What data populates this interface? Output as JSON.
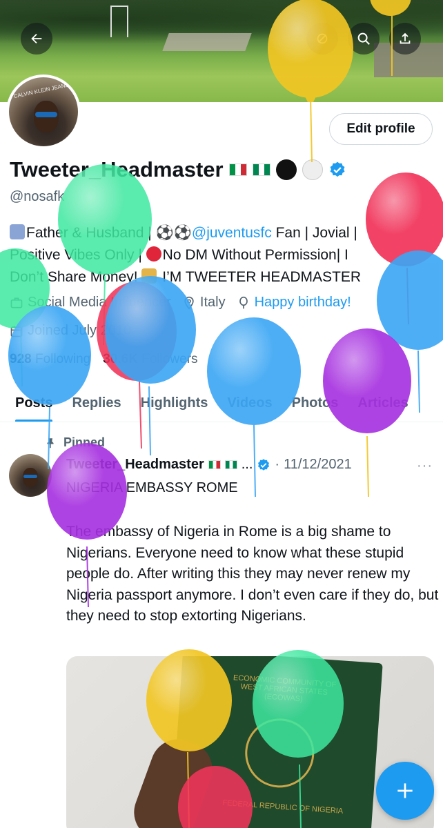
{
  "profile": {
    "name": "Tweeter_Headmaster",
    "handle": "@nosafk",
    "edit_label": "Edit profile",
    "bio_line1_a": "Father & Husband | ",
    "bio_line1_link": "@juventusfc",
    "bio_line1_b": " Fan | Jovial |",
    "bio_line2": "Positive Vibes Only | ",
    "bio_line2_b": "No DM Without Permission| I",
    "bio_line3": "Don’t Share Money! ",
    "bio_line3_b": " I’M TWEETER HEADMASTER",
    "category": "Social Media Influencer",
    "location": "Italy",
    "birthday": "Happy birthday!",
    "joined": "Joined July 2010",
    "following_count": "928",
    "following_label": "Following",
    "followers_count": "30.6K",
    "followers_label": "Followers",
    "avatar_sign": "CALVIN KLEIN JEANS"
  },
  "tabs": [
    "Posts",
    "Replies",
    "Highlights",
    "Videos",
    "Photos",
    "Articles"
  ],
  "tweet": {
    "pinned_label": "Pinned",
    "author": "Tweeter_Headmaster",
    "ellipsis": "...",
    "separator": "·",
    "date": "11/12/2021",
    "more": "···",
    "title": "NIGERIA EMBASSY ROME",
    "body": "The embassy of Nigeria in Rome is a big shame to Nigerians. Everyone need to know what these stupid people do. After writing this they may never renew my Nigeria passport anymore. I don’t even care if they do, but they need to stop extorting Nigerians.",
    "media_text_top": "ECONOMIC COMMUNITY OF WEST AFRICAN STATES (ECOWAS)",
    "media_text_bottom": "FEDERAL REPUBLIC OF NIGERIA"
  },
  "colors": {
    "accent": "#1d9bf0",
    "balloon_yellow": "#f2c623",
    "balloon_green": "#3ee8a0",
    "balloon_red": "#f1345a",
    "balloon_blue": "#3aa6f5",
    "balloon_purple": "#a62fe0"
  },
  "icons": [
    "back-arrow-icon",
    "circle-slash-icon",
    "search-icon",
    "share-icon",
    "verified-badge-icon",
    "briefcase-icon",
    "location-pin-icon",
    "balloon-icon",
    "calendar-icon",
    "pin-icon",
    "compose-plus-icon"
  ]
}
